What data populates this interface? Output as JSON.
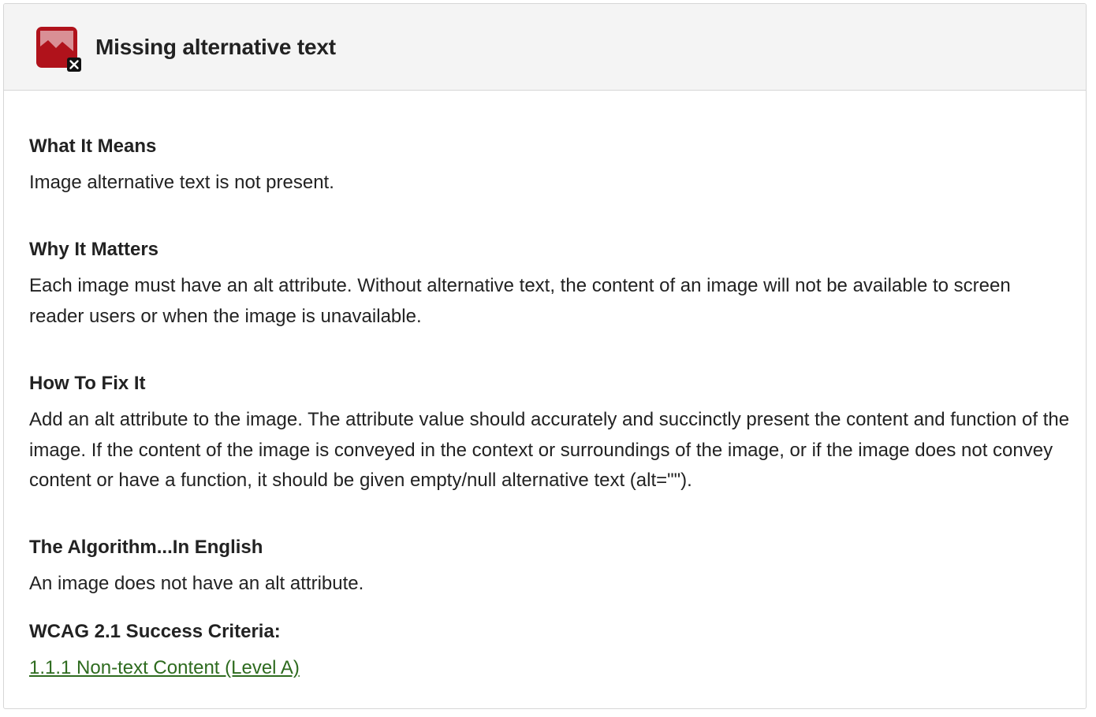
{
  "header": {
    "title": "Missing alternative text",
    "icon": "missing-image-alt-icon",
    "icon_color": "#b0121b"
  },
  "sections": [
    {
      "heading": "What It Means",
      "text": "Image alternative text is not present."
    },
    {
      "heading": "Why It Matters",
      "text": "Each image must have an alt attribute. Without alternative text, the content of an image will not be available to screen reader users or when the image is unavailable."
    },
    {
      "heading": "How To Fix It",
      "text": "Add an alt attribute to the image. The attribute value should accurately and succinctly present the content and function of the image. If the content of the image is conveyed in the context or surroundings of the image, or if the image does not convey content or have a function, it should be given empty/null alternative text (alt=\"\")."
    },
    {
      "heading": "The Algorithm...In English",
      "text": "An image does not have an alt attribute."
    }
  ],
  "wcag": {
    "heading": "WCAG 2.1 Success Criteria:",
    "link_label": "1.1.1 Non-text Content (Level A) ",
    "link_color": "#2e6b1f"
  }
}
